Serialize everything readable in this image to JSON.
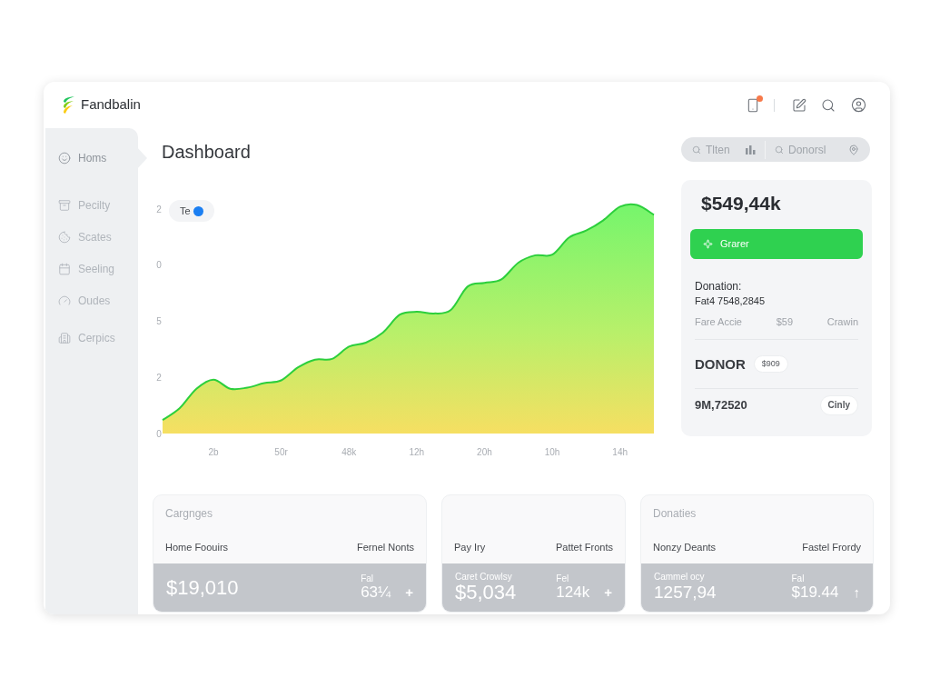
{
  "app": {
    "name": "Fandbalin"
  },
  "sidebar": {
    "items": [
      {
        "label": "Homs",
        "selected": true
      },
      {
        "label": "Pecilty",
        "selected": false
      },
      {
        "label": "Scates",
        "selected": false
      },
      {
        "label": "Seeling",
        "selected": false
      },
      {
        "label": "Oudes",
        "selected": false
      },
      {
        "label": "Cerpics",
        "selected": false
      }
    ]
  },
  "page": {
    "title": "Dashboard"
  },
  "search_bar": {
    "fields": [
      {
        "placeholder": "Tlten"
      },
      {
        "placeholder": "Donorsl"
      }
    ]
  },
  "chart": {
    "legend": "Te",
    "y_axis_labels": [
      "2",
      "0",
      "5",
      "2",
      "0"
    ],
    "x_axis_labels": [
      "2b",
      "50r",
      "48k",
      "12h",
      "20h",
      "10h",
      "14h"
    ]
  },
  "summary_panel": {
    "total": "$549,44k",
    "button": "Grarer",
    "donation_label": "Donation:",
    "donation_value": "Fat4 7548,2845",
    "detail_row": [
      "Fare Accie",
      "$59",
      "Crawin"
    ],
    "donor": {
      "label": "DONOR",
      "badge": "$909"
    },
    "footer": {
      "value": "9M,72520",
      "badge": "Cinly"
    }
  },
  "cards": [
    {
      "title": "Cargnges",
      "row": [
        "Home Foouirs",
        "Fernel Nonts"
      ],
      "total": {
        "value": "$19,010"
      },
      "change": {
        "label": "Fal",
        "value": "63¼",
        "arrow": "+"
      }
    },
    {
      "row": [
        "Pay Iry",
        "Pattet Fronts"
      ],
      "total": {
        "caption": "Caret Crowlsy",
        "value": "$5,034"
      },
      "change": {
        "label": "Fel",
        "value": "124k",
        "arrow": "+"
      }
    },
    {
      "title": "Donaties",
      "row": [
        "Nonzy Deants",
        "Fastel Frordy"
      ],
      "total": {
        "caption": "Cammel ocy",
        "value": "1257,94"
      },
      "change": {
        "label": "Fal",
        "value": "$19.44",
        "arrow": "↑"
      }
    }
  ]
}
